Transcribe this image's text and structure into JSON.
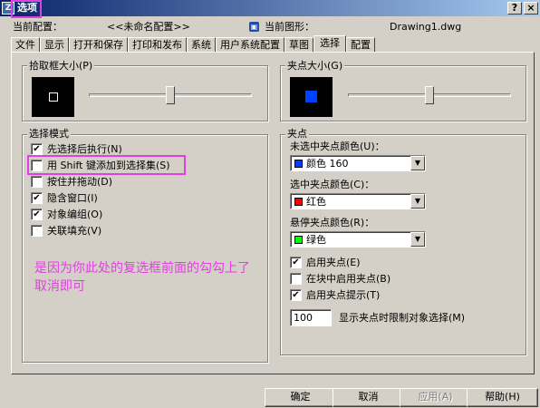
{
  "window": {
    "title": "选项",
    "icon_glyph": "Z",
    "help_button": "?",
    "close_button": "×"
  },
  "config": {
    "current_config_label": "当前配置：",
    "current_config_value": "<<未命名配置>>",
    "current_drawing_label": "当前图形：",
    "current_drawing_value": "Drawing1.dwg"
  },
  "tabs": [
    {
      "label": "文件"
    },
    {
      "label": "显示"
    },
    {
      "label": "打开和保存"
    },
    {
      "label": "打印和发布"
    },
    {
      "label": "系统"
    },
    {
      "label": "用户系统配置"
    },
    {
      "label": "草图"
    },
    {
      "label": "选择",
      "active": true
    },
    {
      "label": "配置"
    }
  ],
  "pickbox": {
    "title": "拾取框大小(P)",
    "slider_fraction": 0.5
  },
  "grip_size": {
    "title": "夹点大小(G)",
    "slider_fraction": 0.5
  },
  "selection_mode": {
    "title": "选择模式",
    "options": [
      {
        "label": "先选择后执行(N)",
        "checked": true
      },
      {
        "label": "用 Shift 键添加到选择集(S)",
        "checked": false
      },
      {
        "label": "按住并拖动(D)",
        "checked": false
      },
      {
        "label": "隐含窗口(I)",
        "checked": true
      },
      {
        "label": "对象编组(O)",
        "checked": true
      },
      {
        "label": "关联填充(V)",
        "checked": false
      }
    ]
  },
  "grips": {
    "title": "夹点",
    "unselected_color_label": "未选中夹点颜色(U)：",
    "unselected_color_value": "颜色 160",
    "unselected_color_hex": "#0040ff",
    "selected_color_label": "选中夹点颜色(C)：",
    "selected_color_value": "红色",
    "selected_color_hex": "#ff0000",
    "hover_color_label": "悬停夹点颜色(R)：",
    "hover_color_value": "绿色",
    "hover_color_hex": "#00ff00",
    "options": [
      {
        "label": "启用夹点(E)",
        "checked": true
      },
      {
        "label": "在块中启用夹点(B)",
        "checked": false
      },
      {
        "label": "启用夹点提示(T)",
        "checked": true
      }
    ],
    "limit_value": "100",
    "limit_label": "显示夹点时限制对象选择(M)"
  },
  "annotation": {
    "text": "是因为你此处的复选框前面的勾勾上了取消即可",
    "color": "#e040e0"
  },
  "buttons": {
    "ok": "确定",
    "cancel": "取消",
    "apply": "应用(A)",
    "help": "帮助(H)"
  },
  "glyphs": {
    "check": "✔",
    "dropdown": "▼"
  }
}
